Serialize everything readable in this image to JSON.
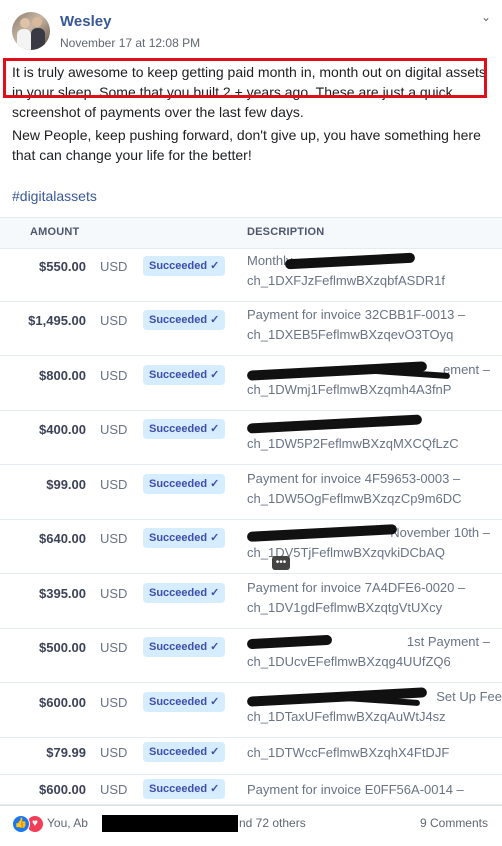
{
  "post": {
    "author": "Wesley",
    "timestamp": "November 17 at 12:08 PM",
    "menu_icon": "chevron-down-icon",
    "paragraph1": "It is truly awesome to keep getting paid month in, month out on digital assets in your sleep. Some that you built 2 + years ago. These are just a quick screenshot of payments over the last few days.",
    "paragraph2": "New People, keep pushing forward, don't give up, you have something here that can change your life for the better!",
    "hashtag": "#digitalassets",
    "highlight_color": "#e0101a"
  },
  "table": {
    "col_amount": "AMOUNT",
    "col_description": "DESCRIPTION",
    "rows": [
      {
        "amount": "$550.00",
        "currency": "USD",
        "status": "Succeeded",
        "desc1": "Monthly",
        "desc2": "ch_1DXFJzFeflmwBXzqbfASDR1f"
      },
      {
        "amount": "$1,495.00",
        "currency": "USD",
        "status": "Succeeded",
        "desc1": "Payment for invoice 32CBB1F-0013 –",
        "desc2": "ch_1DXEB5FeflmwBXzqevO3TOyq"
      },
      {
        "amount": "$800.00",
        "currency": "USD",
        "status": "Succeeded",
        "desc1": "ement –",
        "desc2": "ch_1DWmj1FeflmwBXzqmh4A3fnP"
      },
      {
        "amount": "$400.00",
        "currency": "USD",
        "status": "Succeeded",
        "desc1": "",
        "desc2": "ch_1DW5P2FeflmwBXzqMXCQfLzC"
      },
      {
        "amount": "$99.00",
        "currency": "USD",
        "status": "Succeeded",
        "desc1": "Payment for invoice 4F59653-0003 –",
        "desc2": "ch_1DW5OgFeflmwBXzqzCp9m6DC"
      },
      {
        "amount": "$640.00",
        "currency": "USD",
        "status": "Succeeded",
        "desc1": "November 10th –",
        "desc2": "ch_1DV5TjFeflmwBXzqvkiDCbAQ"
      },
      {
        "amount": "$395.00",
        "currency": "USD",
        "status": "Succeeded",
        "desc1": "Payment for invoice 7A4DFE6-0020 –",
        "desc2": "ch_1DV1gdFeflmwBXzqtgVtUXcy"
      },
      {
        "amount": "$500.00",
        "currency": "USD",
        "status": "Succeeded",
        "desc1": "1st Payment –",
        "desc2": "ch_1DUcvEFeflmwBXzqg4UUfZQ6"
      },
      {
        "amount": "$600.00",
        "currency": "USD",
        "status": "Succeeded",
        "desc1": "Set Up Fee",
        "desc2": "ch_1DTaxUFeflmwBXzqAuWtJ4sz"
      },
      {
        "amount": "$79.99",
        "currency": "USD",
        "status": "Succeeded",
        "desc1": "ch_1DTWccFeflmwBXzqhX4FtDJF",
        "desc2": ""
      },
      {
        "amount": "$600.00",
        "currency": "USD",
        "status": "Succeeded",
        "desc1": "Payment for invoice E0FF56A-0014 –",
        "desc2": ""
      }
    ]
  },
  "footer": {
    "reactions_prefix": "You, Ab",
    "reactions_suffix": "nd 72 others",
    "comments": "9 Comments",
    "like_icon": "like-icon",
    "love_icon": "love-icon"
  }
}
